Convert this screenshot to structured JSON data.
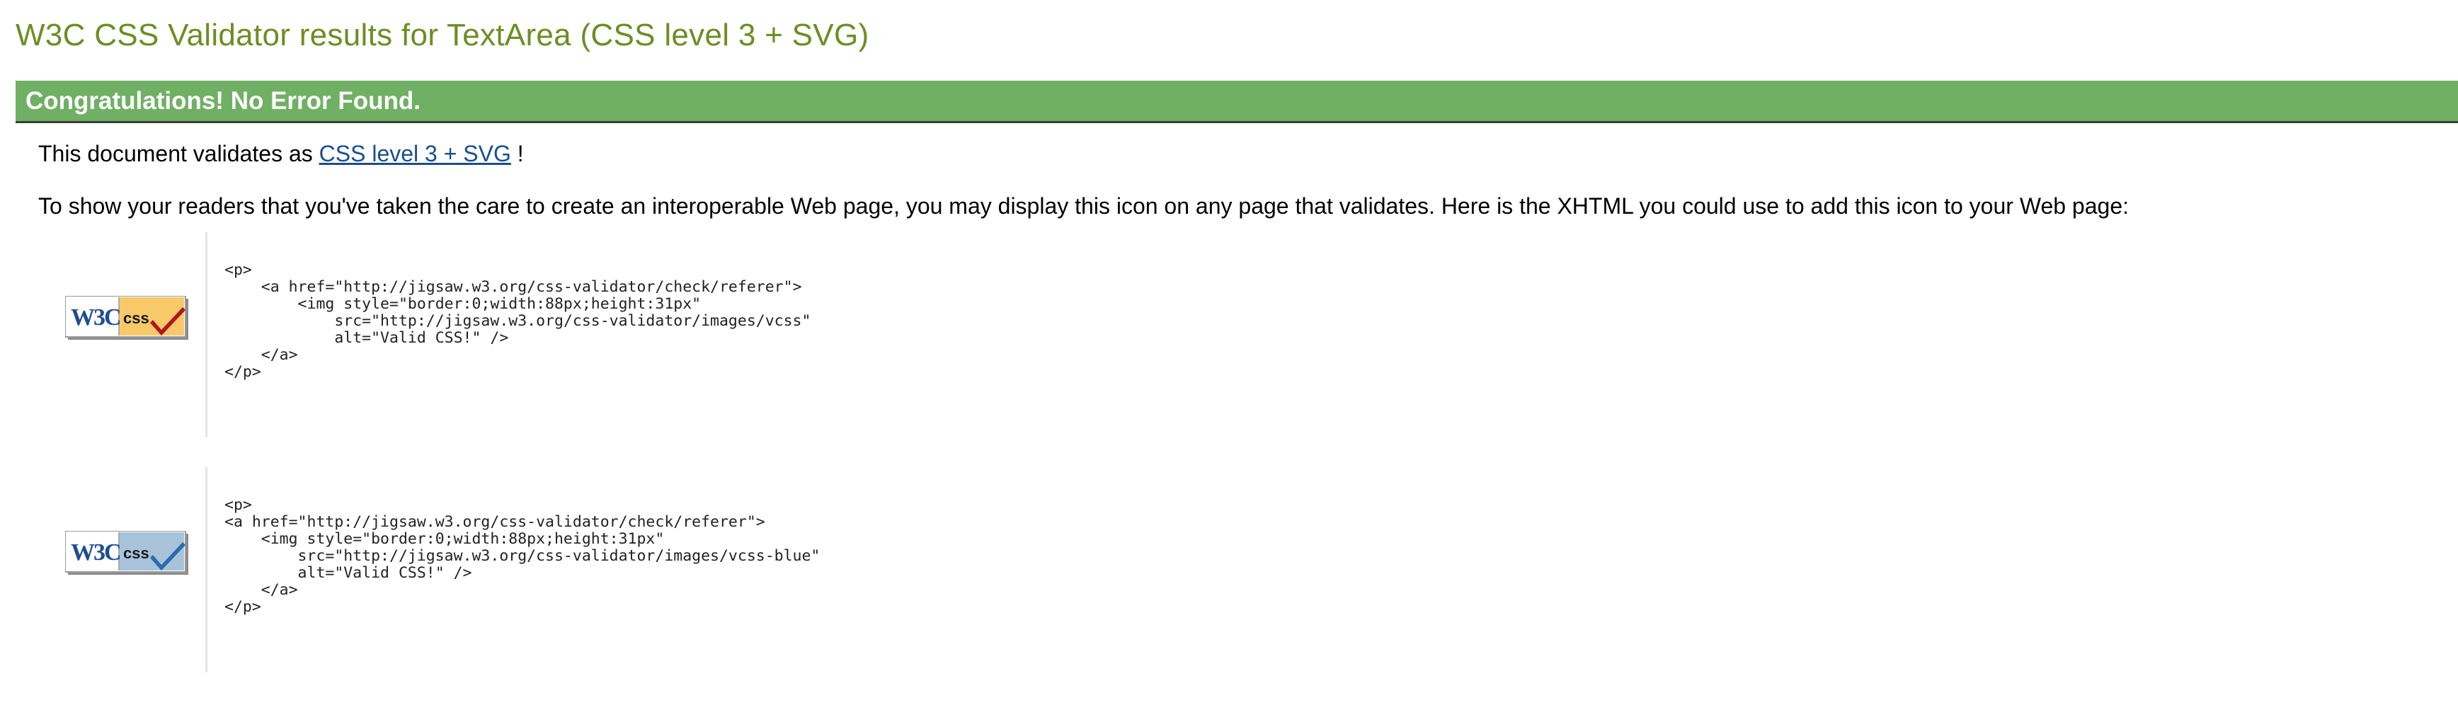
{
  "colors": {
    "title": "#6b8e23",
    "banner_bg": "#70b064",
    "banner_text": "#ffffff",
    "link": "#1a4d8f",
    "badge_css_orange": "#f7c969",
    "badge_css_blue": "#a8c3d9",
    "check_red": "#b0161b",
    "check_blue": "#2a6bb0",
    "w3c_blue": "#1f4e8f"
  },
  "page": {
    "title": "W3C CSS Validator results for TextArea (CSS level 3 + SVG)"
  },
  "banner": {
    "text": "Congratulations! No Error Found."
  },
  "validates": {
    "prefix": "This document validates as",
    "link_text": "CSS level 3 + SVG",
    "suffix": "!"
  },
  "info": {
    "text": "To show your readers that you've taken the care to create an interoperable Web page, you may display this icon on any page that validates. Here is the XHTML you could use to add this icon to your Web page:"
  },
  "icons": [
    {
      "badge": {
        "w3c_text": "W3C",
        "css_text": "css",
        "icon": "check-red-icon"
      },
      "code": "<p>\n    <a href=\"http://jigsaw.w3.org/css-validator/check/referer\">\n        <img style=\"border:0;width:88px;height:31px\"\n            src=\"http://jigsaw.w3.org/css-validator/images/vcss\"\n            alt=\"Valid CSS!\" />\n    </a>\n</p>"
    },
    {
      "badge": {
        "w3c_text": "W3C",
        "css_text": "css",
        "icon": "check-blue-icon"
      },
      "code": "<p>\n<a href=\"http://jigsaw.w3.org/css-validator/check/referer\">\n    <img style=\"border:0;width:88px;height:31px\"\n        src=\"http://jigsaw.w3.org/css-validator/images/vcss-blue\"\n        alt=\"Valid CSS!\" />\n    </a>\n</p>"
    }
  ]
}
